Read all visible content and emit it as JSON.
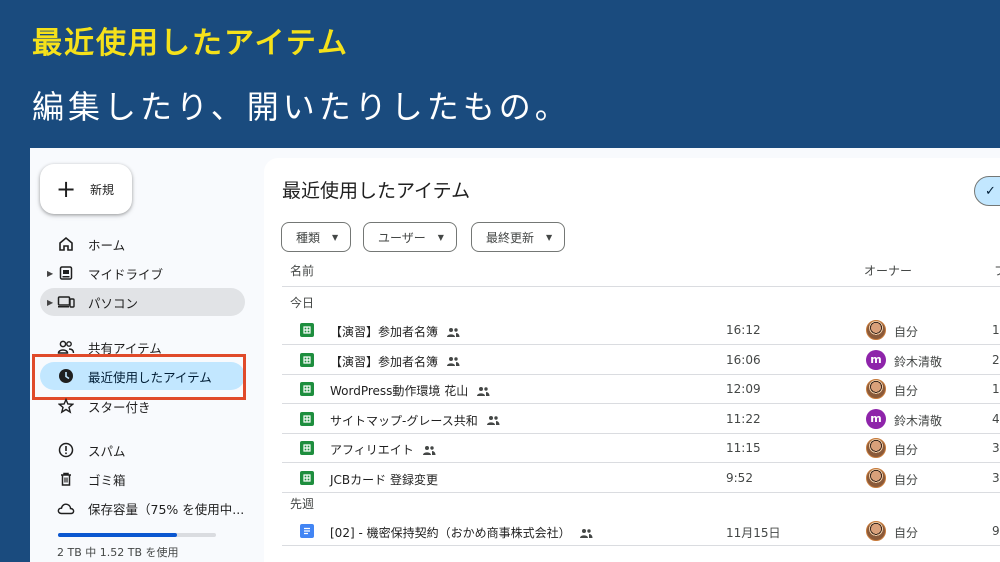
{
  "banner": {
    "title": "最近使用したアイテム",
    "subtitle": "編集したり、開いたりしたもの。"
  },
  "sidebar": {
    "new_label": "新規",
    "items": [
      {
        "label": "ホーム",
        "icon": "home-icon"
      },
      {
        "label": "マイドライブ",
        "icon": "my-drive-icon"
      },
      {
        "label": "パソコン",
        "icon": "computers-icon"
      },
      {
        "label": "共有アイテム",
        "icon": "shared-icon"
      },
      {
        "label": "最近使用したアイテム",
        "icon": "clock-icon"
      },
      {
        "label": "スター付き",
        "icon": "star-icon"
      },
      {
        "label": "スパム",
        "icon": "spam-icon"
      },
      {
        "label": "ゴミ箱",
        "icon": "trash-icon"
      },
      {
        "label": "保存容量（75% を使用中...",
        "icon": "cloud-icon"
      }
    ],
    "storage_fraction": 0.75,
    "storage_text": "2 TB 中 1.52 TB を使用"
  },
  "main": {
    "title": "最近使用したアイテム",
    "view_toggle": "✓",
    "filters": [
      "種類",
      "ユーザー",
      "最終更新"
    ],
    "columns": {
      "name": "名前",
      "owner": "オーナー",
      "extra": "フ"
    },
    "groups": [
      {
        "label": "今日",
        "rows": [
          {
            "name": "【演習】参加者名簿",
            "type": "sheet",
            "shared": true,
            "time": "16:12",
            "owner": "自分",
            "avatar": "photo",
            "extra": "1"
          },
          {
            "name": "【演習】参加者名簿",
            "type": "sheet",
            "shared": true,
            "time": "16:06",
            "owner": "鈴木清敬",
            "avatar": "m",
            "extra": "2"
          },
          {
            "name": "WordPress動作環境 花山",
            "type": "sheet",
            "shared": true,
            "time": "12:09",
            "owner": "自分",
            "avatar": "photo",
            "extra": "1"
          },
          {
            "name": "サイトマップ-グレース共和",
            "type": "sheet",
            "shared": true,
            "time": "11:22",
            "owner": "鈴木清敬",
            "avatar": "m",
            "extra": "4"
          },
          {
            "name": "アフィリエイト",
            "type": "sheet",
            "shared": true,
            "time": "11:15",
            "owner": "自分",
            "avatar": "photo",
            "extra": "3"
          },
          {
            "name": "JCBカード 登録変更",
            "type": "sheet",
            "shared": false,
            "time": "9:52",
            "owner": "自分",
            "avatar": "photo",
            "extra": "3"
          }
        ]
      },
      {
        "label": "先週",
        "rows": [
          {
            "name": "[02] - 機密保持契約（おかめ商事株式会社）",
            "type": "doc",
            "shared": true,
            "time": "11月15日",
            "owner": "自分",
            "avatar": "photo",
            "extra": "9"
          }
        ]
      }
    ]
  },
  "colors": {
    "banner_bg": "#1a4b7e",
    "banner_title": "#f5e11a",
    "active_nav": "#c2e7ff",
    "highlight_border": "#e04a2a",
    "sheet_green": "#1e8e3e",
    "doc_blue": "#4285f4",
    "avatar_purple": "#8e24aa"
  }
}
